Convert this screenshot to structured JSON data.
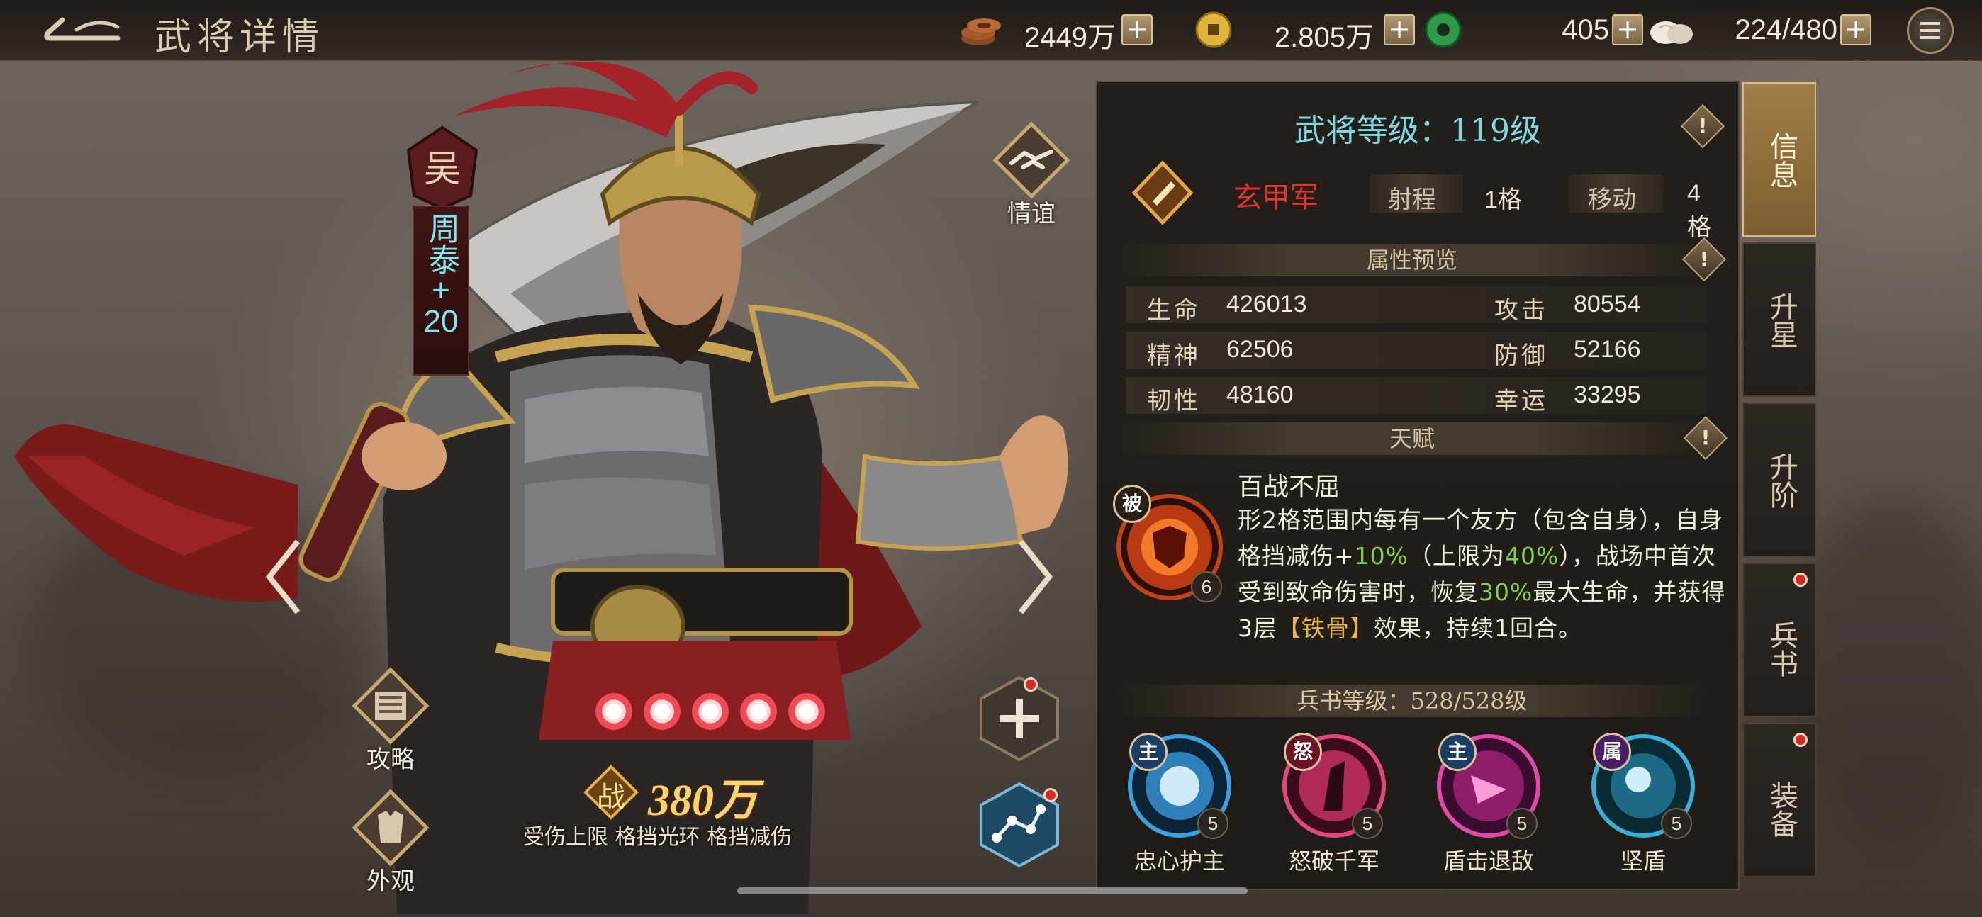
{
  "header": {
    "title": "武将详情",
    "resources": [
      {
        "icon": "copper-coins-icon",
        "value": "2449万"
      },
      {
        "icon": "gold-coin-icon",
        "value": "2.805万"
      },
      {
        "icon": "jade-icon",
        "value": "405"
      },
      {
        "icon": "steamed-bun-icon",
        "value": "224/480"
      }
    ],
    "plus": "+"
  },
  "hero": {
    "faction": "吴",
    "name": "周泰",
    "plus": "+",
    "level_bonus": "20",
    "buttons": {
      "friendship": "情谊",
      "guide": "攻略",
      "appearance": "外观"
    },
    "stars": 5,
    "power_glyph": "战",
    "power": "380万",
    "tags": "受伤上限 格挡光环 格挡减伤"
  },
  "panel": {
    "level_text": "武将等级：119级",
    "troop": {
      "name": "玄甲军",
      "range_label": "射程",
      "range_value": "1格",
      "move_label": "移动",
      "move_value": "4格"
    },
    "attr_title": "属性预览",
    "stats": [
      {
        "label": "生命",
        "value": "426013"
      },
      {
        "label": "攻击",
        "value": "80554"
      },
      {
        "label": "精神",
        "value": "62506"
      },
      {
        "label": "防御",
        "value": "52166"
      },
      {
        "label": "韧性",
        "value": "48160"
      },
      {
        "label": "幸运",
        "value": "33295"
      }
    ],
    "talent_title": "天赋",
    "talent": {
      "badge": "被",
      "level": "6",
      "name": "百战不屈",
      "desc": {
        "p1": "形2格范围内每有一个友方（包含自身），自身格挡减伤+",
        "v1": "10%",
        "p2": "（上限为",
        "v2": "40%",
        "p3": "），战场中首次受到致命伤害时，恢复",
        "v3": "30%",
        "p4": "最大生命，并获得3层",
        "v4": "【铁骨】",
        "p5": "效果，持续1回合。"
      }
    },
    "book_title": "兵书等级：528/528级",
    "skills": [
      {
        "tag": "主",
        "name": "忠心护主",
        "level": "5",
        "color": "#3aa0e0"
      },
      {
        "tag": "怒",
        "name": "怒破千军",
        "level": "5",
        "color": "#e04a7a"
      },
      {
        "tag": "主",
        "name": "盾击退敌",
        "level": "5",
        "color": "#e04aa8"
      },
      {
        "tag": "属",
        "name": "坚盾",
        "level": "5",
        "color": "#3ab0d8"
      }
    ],
    "info_mark": "!"
  },
  "tabs": [
    {
      "label": "信息",
      "active": true
    },
    {
      "label": "升星",
      "active": false
    },
    {
      "label": "升阶",
      "active": false
    },
    {
      "label": "兵书",
      "active": false
    },
    {
      "label": "装备",
      "active": false
    }
  ],
  "colors": {
    "level_text": "#7fd8e0",
    "troop_name": "#e0352b",
    "highlight_green": "#7fd04a",
    "highlight_yellow": "#e8b648",
    "power": "#ffd271"
  }
}
